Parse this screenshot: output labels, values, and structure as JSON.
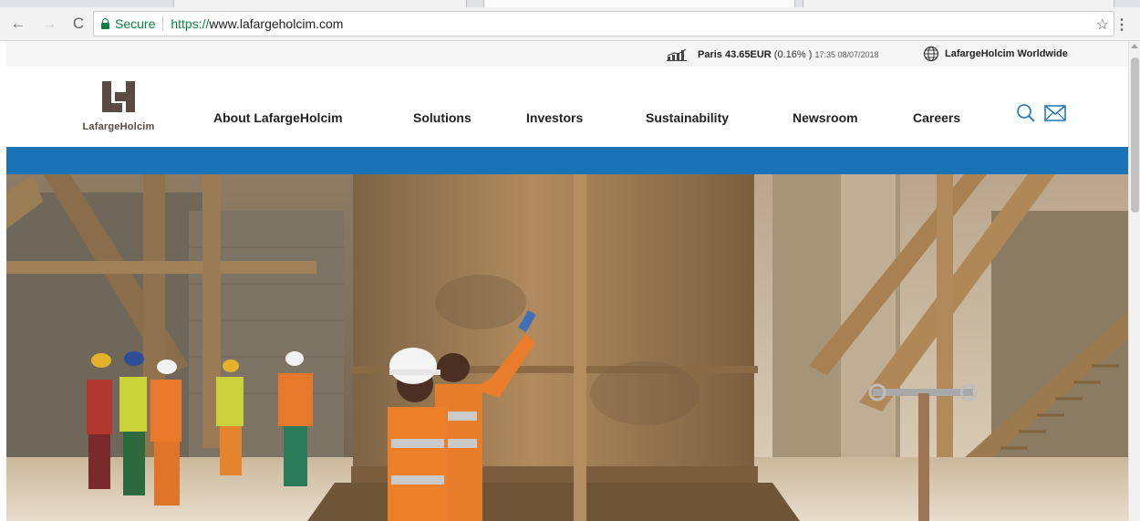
{
  "browser": {
    "secure_label": "Secure",
    "url_scheme": "https://",
    "url_rest": "www.lafargeholcim.com",
    "icons": [
      "back-arrow-icon",
      "forward-arrow-icon",
      "reload-icon",
      "lock-icon",
      "star-icon",
      "menu-dots-icon"
    ]
  },
  "topbar": {
    "stock_label": "Paris 43.65EUR",
    "stock_change": "(0.16%",
    "stock_paren_close": ")",
    "stock_time": "17:35 08/07/2018",
    "worldwide": "LafargeHolcim Worldwide"
  },
  "header": {
    "logo_text": "LafargeHolcim",
    "nav": [
      "About LafargeHolcim",
      "Solutions",
      "Investors",
      "Sustainability",
      "Newsroom",
      "Careers"
    ]
  },
  "colors": {
    "brand_blue": "#1a73b7",
    "logo_brown": "#5a4a42",
    "secure_green": "#0b8043"
  }
}
